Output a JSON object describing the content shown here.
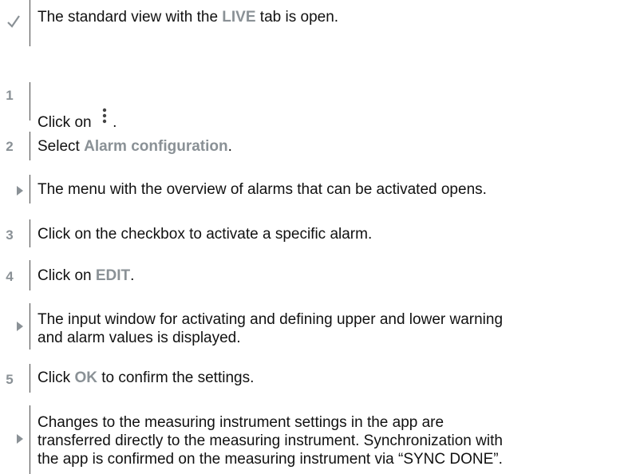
{
  "steps": [
    {
      "marker": "check",
      "parts": [
        {
          "t": "The standard view with the ",
          "h": false
        },
        {
          "t": "LIVE",
          "h": true
        },
        {
          "t": " tab is open.",
          "h": false
        }
      ]
    },
    {
      "marker": "1",
      "parts": [
        {
          "t": "Click on ",
          "h": false
        }
      ],
      "icon": "more-vertical-icon",
      "after": "."
    },
    {
      "marker": "2",
      "parts": [
        {
          "t": "Select ",
          "h": false
        },
        {
          "t": "Alarm configuration",
          "h": true
        },
        {
          "t": ".",
          "h": false
        }
      ]
    },
    {
      "marker": "arrow",
      "parts": [
        {
          "t": "The menu with the overview of alarms that can be activated opens.",
          "h": false
        }
      ]
    },
    {
      "marker": "3",
      "parts": [
        {
          "t": "Click on the checkbox to activate a specific alarm.",
          "h": false
        }
      ]
    },
    {
      "marker": "4",
      "parts": [
        {
          "t": "Click on ",
          "h": false
        },
        {
          "t": "EDIT",
          "h": true
        },
        {
          "t": ".",
          "h": false
        }
      ]
    },
    {
      "marker": "arrow",
      "lines": [
        "The input window for activating and defining upper and lower warning",
        "and alarm values is displayed."
      ]
    },
    {
      "marker": "5",
      "parts": [
        {
          "t": "Click ",
          "h": false
        },
        {
          "t": "OK",
          "h": true
        },
        {
          "t": " to confirm the settings.",
          "h": false
        }
      ]
    },
    {
      "marker": "arrow",
      "lines": [
        "Changes to the measuring instrument settings in the app are",
        "transferred directly to the measuring instrument. Synchronization with",
        "the app is confirmed on the measuring instrument via “SYNC DONE”."
      ]
    }
  ],
  "colors": {
    "highlight": "#8a9196",
    "text": "#111111",
    "check": "#8a9196",
    "arrow": "#8a9196",
    "rule": "#4a4a4a"
  }
}
